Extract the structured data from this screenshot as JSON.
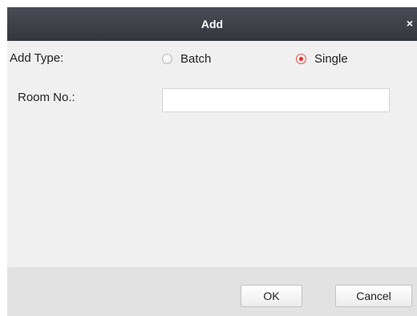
{
  "dialog": {
    "title": "Add",
    "close_glyph": "×"
  },
  "form": {
    "add_type_label": "Add Type:",
    "options": [
      {
        "label": "Batch",
        "selected": false
      },
      {
        "label": "Single",
        "selected": true
      }
    ],
    "room_no_label": "Room No.:",
    "room_no_value": "",
    "room_no_placeholder": ""
  },
  "footer": {
    "ok_label": "OK",
    "cancel_label": "Cancel"
  },
  "colors": {
    "title_bar": "#3a3d44",
    "dialog_bg": "#f0f0f0",
    "footer_bg": "#e2e2e2",
    "radio_accent": "#e52a2a"
  },
  "icons": {
    "close": "close-icon"
  }
}
